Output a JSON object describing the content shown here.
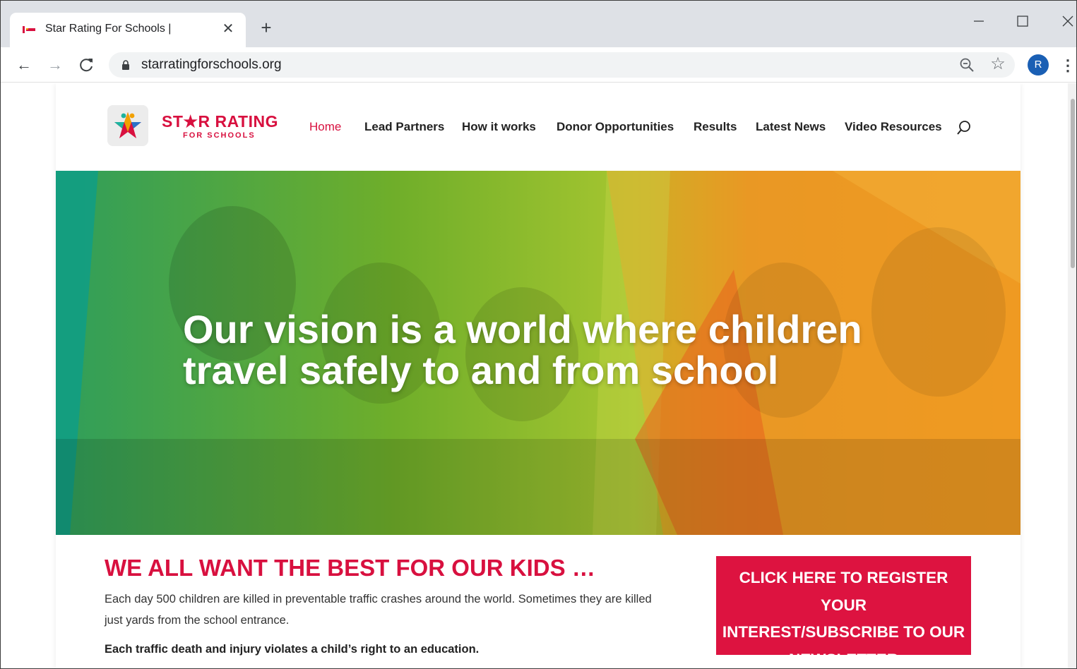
{
  "browser": {
    "tab_title": "Star Rating For Schools |",
    "url": "starratingforschools.org",
    "profile_initial": "R",
    "accent": "#1a5fb4"
  },
  "site": {
    "logo_main": "ST★R RATING",
    "logo_sub": "FOR SCHOOLS",
    "brand_color": "#d8103f",
    "nav": [
      "Home",
      "Lead Partners",
      "How it works",
      "Donor Opportunities",
      "Results",
      "Latest News",
      "Video Resources"
    ],
    "nav_active": "Home"
  },
  "hero": {
    "heading_line1": "Our vision is a world where children",
    "heading_line2": "travel safely to and from school"
  },
  "content": {
    "title": "WE ALL WANT THE BEST FOR OUR KIDS …",
    "paragraph": "Each day 500 children are killed in preventable traffic crashes around the world. Sometimes they are killed just yards from the school entrance.",
    "bold_statement": "Each traffic death and injury violates a child’s right to an education.",
    "cta_line1": "CLICK HERE TO REGISTER YOUR",
    "cta_line2": "INTEREST/SUBSCRIBE TO OUR",
    "cta_line3": "NEWSLETTER"
  }
}
